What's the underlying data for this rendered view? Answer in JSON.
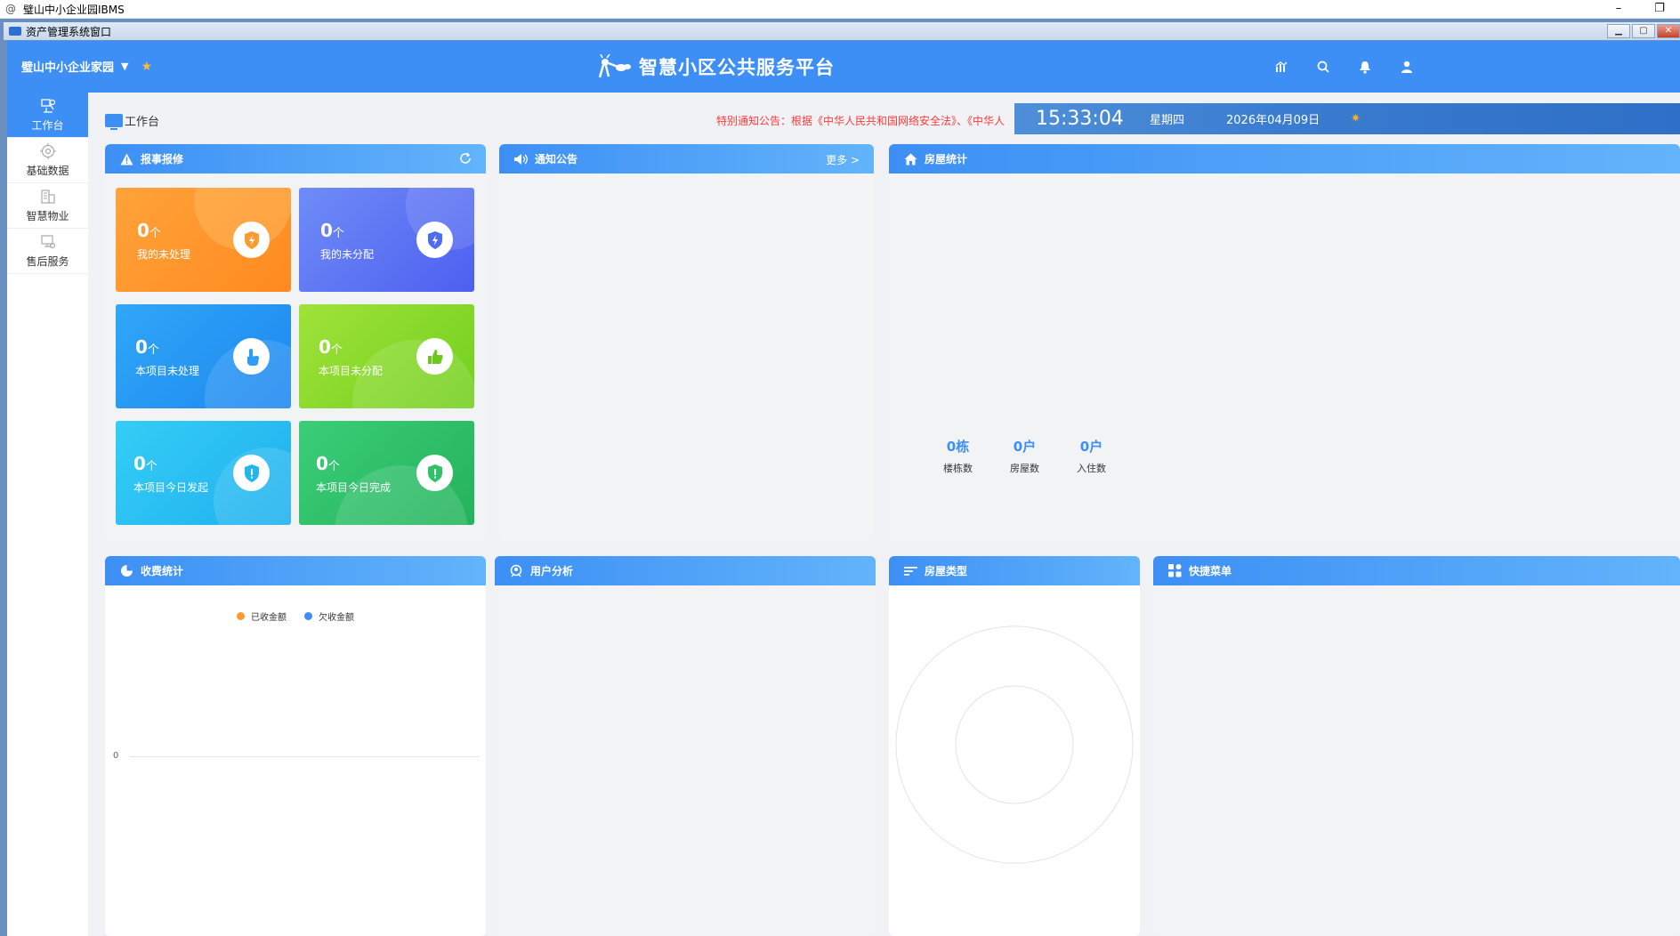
{
  "os_window": {
    "title": "璧山中小企业园IBMS",
    "minimize": "–",
    "restore": "❐"
  },
  "inner_window": {
    "title": "资产管理系统窗口"
  },
  "header": {
    "org_name": "璧山中小企业家园",
    "brand_title": "智慧小区公共服务平台",
    "icons": [
      "chart-icon",
      "search-icon",
      "bell-icon",
      "user-icon"
    ],
    "color": "#3d8ff5"
  },
  "sidebar": {
    "items": [
      {
        "label": "工作台",
        "icon": "workbench-icon",
        "active": true
      },
      {
        "label": "基础数据",
        "icon": "gear-icon",
        "active": false
      },
      {
        "label": "智慧物业",
        "icon": "building-icon",
        "active": false
      },
      {
        "label": "售后服务",
        "icon": "service-icon",
        "active": false
      }
    ]
  },
  "page": {
    "title": "工作台",
    "notice": "特别通知公告：根据《中华人民共和国网络安全法》、《中华人",
    "time": "15:33:04",
    "weekday": "星期四",
    "date": "2026年04月09日",
    "weather_icon": "sun-icon"
  },
  "repair_panel": {
    "title": "报事报修",
    "tiles": [
      {
        "count": "0",
        "unit": "个",
        "label": "我的未处理",
        "icon": "shield-bolt-icon",
        "color": "#ff9a2e"
      },
      {
        "count": "0",
        "unit": "个",
        "label": "我的未分配",
        "icon": "shield-bolt-icon",
        "color": "#5b73f5"
      },
      {
        "count": "0",
        "unit": "个",
        "label": "本项目未处理",
        "icon": "hand-pointer-icon",
        "color": "#2f9cf6"
      },
      {
        "count": "0",
        "unit": "个",
        "label": "本项目未分配",
        "icon": "thumbs-up-icon",
        "color": "#86d92a"
      },
      {
        "count": "0",
        "unit": "个",
        "label": "本项目今日发起",
        "icon": "shield-alert-icon",
        "color": "#28c0f2"
      },
      {
        "count": "0",
        "unit": "个",
        "label": "本项目今日完成",
        "icon": "shield-alert-icon",
        "color": "#2fc26b"
      }
    ]
  },
  "notice_panel": {
    "title": "通知公告",
    "more": "更多 >"
  },
  "house_panel": {
    "title": "房屋统计",
    "stats": [
      {
        "value": "0栋",
        "label": "楼栋数"
      },
      {
        "value": "0户",
        "label": "房屋数"
      },
      {
        "value": "0户",
        "label": "入住数"
      }
    ]
  },
  "fee_panel": {
    "title": "收费统计",
    "axis_zero": "0"
  },
  "user_panel": {
    "title": "用户分析"
  },
  "house_type_panel": {
    "title": "房屋类型"
  },
  "quick_panel": {
    "title": "快捷菜单"
  },
  "chart_data": {
    "type": "bar",
    "series": [
      {
        "name": "已收金额",
        "values": [],
        "color": "#ff9a2e"
      },
      {
        "name": "欠收金额",
        "values": [],
        "color": "#3d8ff5"
      }
    ],
    "categories": [],
    "y_ticks": [
      "0"
    ],
    "legend_position": "top-center"
  }
}
